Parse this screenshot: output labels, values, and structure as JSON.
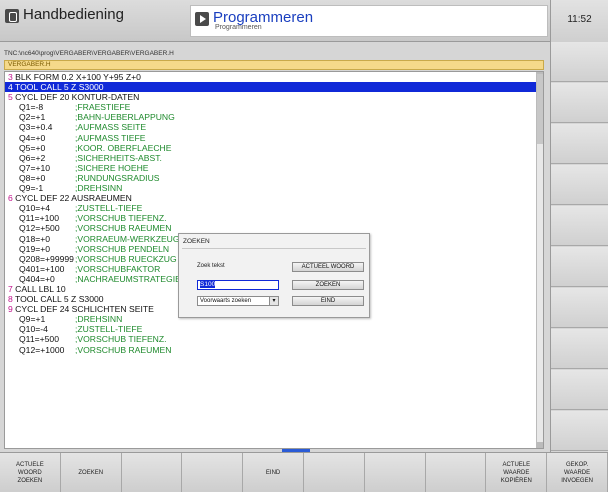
{
  "header": {
    "left_mode": "Handbediening",
    "right_mode": "Programmeren",
    "right_sub": "Programmeren",
    "clock": "11:52"
  },
  "path": "TNC:\\nc640\\prog\\VERGABER\\VERGABER\\VERGABER.H",
  "program_title": "VERGABER.H",
  "editor": {
    "lines": [
      {
        "num": "3",
        "text": " BLK FORM 0.2  X+100  Y+95  Z+0",
        "selected": false,
        "indent": false,
        "comment": ""
      },
      {
        "num": "4",
        "text": " TOOL CALL 5 Z S3000",
        "selected": true,
        "indent": false,
        "comment": ""
      },
      {
        "num": "5",
        "text": " CYCL DEF 20 KONTUR-DATEN",
        "selected": false,
        "indent": false,
        "comment": ""
      },
      {
        "num": "",
        "text": "Q1=-8",
        "selected": false,
        "indent": true,
        "comment": ";FRAESTIEFE"
      },
      {
        "num": "",
        "text": "Q2=+1",
        "selected": false,
        "indent": true,
        "comment": ";BAHN-UEBERLAPPUNG"
      },
      {
        "num": "",
        "text": "Q3=+0.4",
        "selected": false,
        "indent": true,
        "comment": ";AUFMASS SEITE"
      },
      {
        "num": "",
        "text": "Q4=+0",
        "selected": false,
        "indent": true,
        "comment": ";AUFMASS TIEFE"
      },
      {
        "num": "",
        "text": "Q5=+0",
        "selected": false,
        "indent": true,
        "comment": ";KOOR. OBERFLAECHE"
      },
      {
        "num": "",
        "text": "Q6=+2",
        "selected": false,
        "indent": true,
        "comment": ";SICHERHEITS-ABST."
      },
      {
        "num": "",
        "text": "Q7=+10",
        "selected": false,
        "indent": true,
        "comment": ";SICHERE HOEHE"
      },
      {
        "num": "",
        "text": "Q8=+0",
        "selected": false,
        "indent": true,
        "comment": ";RUNDUNGSRADIUS"
      },
      {
        "num": "",
        "text": "Q9=-1",
        "selected": false,
        "indent": true,
        "comment": ";DREHSINN"
      },
      {
        "num": "6",
        "text": " CYCL DEF 22 AUSRAEUMEN",
        "selected": false,
        "indent": false,
        "comment": ""
      },
      {
        "num": "",
        "text": "Q10=+4",
        "selected": false,
        "indent": true,
        "comment": ";ZUSTELL-TIEFE"
      },
      {
        "num": "",
        "text": "Q11=+100",
        "selected": false,
        "indent": true,
        "comment": ";VORSCHUB TIEFENZ."
      },
      {
        "num": "",
        "text": "Q12=+500",
        "selected": false,
        "indent": true,
        "comment": ";VORSCHUB RAEUMEN"
      },
      {
        "num": "",
        "text": "Q18=+0",
        "selected": false,
        "indent": true,
        "comment": ";VORRAEUM-WERKZEUG"
      },
      {
        "num": "",
        "text": "Q19=+0",
        "selected": false,
        "indent": true,
        "comment": ";VORSCHUB PENDELN"
      },
      {
        "num": "",
        "text": "Q208=+99999",
        "selected": false,
        "indent": true,
        "comment": ";VORSCHUB RUECKZUG"
      },
      {
        "num": "",
        "text": "Q401=+100",
        "selected": false,
        "indent": true,
        "comment": ";VORSCHUBFAKTOR"
      },
      {
        "num": "",
        "text": "Q404=+0",
        "selected": false,
        "indent": true,
        "comment": ";NACHRAEUMSTRATEGIE"
      },
      {
        "num": "7",
        "text": " CALL LBL 10",
        "selected": false,
        "indent": false,
        "comment": ""
      },
      {
        "num": "8",
        "text": " TOOL CALL 5 Z S3000",
        "selected": false,
        "indent": false,
        "comment": ""
      },
      {
        "num": "9",
        "text": " CYCL DEF 24 SCHLICHTEN SEITE",
        "selected": false,
        "indent": false,
        "comment": ""
      },
      {
        "num": "",
        "text": "Q9=+1",
        "selected": false,
        "indent": true,
        "comment": ";DREHSINN"
      },
      {
        "num": "",
        "text": "Q10=-4",
        "selected": false,
        "indent": true,
        "comment": ";ZUSTELL-TIEFE"
      },
      {
        "num": "",
        "text": "Q11=+500",
        "selected": false,
        "indent": true,
        "comment": ";VORSCHUB TIEFENZ."
      },
      {
        "num": "",
        "text": "Q12=+1000",
        "selected": false,
        "indent": true,
        "comment": ";VORSCHUB RAEUMEN"
      }
    ]
  },
  "dialog": {
    "title": "ZOEKEN",
    "search_label": "Zoek tekst",
    "current_word_button": "ACTUEEL WOORD",
    "search_value": "S100",
    "search_button": "ZOEKEN",
    "direction_value": "Voorwaarts zoeken",
    "end_button": "EIND"
  },
  "bottom_softkeys": [
    {
      "label": "ACTUELE\nWOORD\nZOEKEN"
    },
    {
      "label": "ZOEKEN"
    },
    {
      "label": ""
    },
    {
      "label": ""
    },
    {
      "label": "EIND"
    },
    {
      "label": ""
    },
    {
      "label": ""
    },
    {
      "label": ""
    },
    {
      "label": "ACTUELE\nWAARDE\nKOPIËREN"
    },
    {
      "label": "GEKOP.\nWAARDE\nINVOEGEN"
    }
  ],
  "colors": {
    "selection": "#1029d8",
    "comment": "#1f8a2d",
    "block_number": "#c0128c",
    "title_bar": "#f5d98a"
  }
}
